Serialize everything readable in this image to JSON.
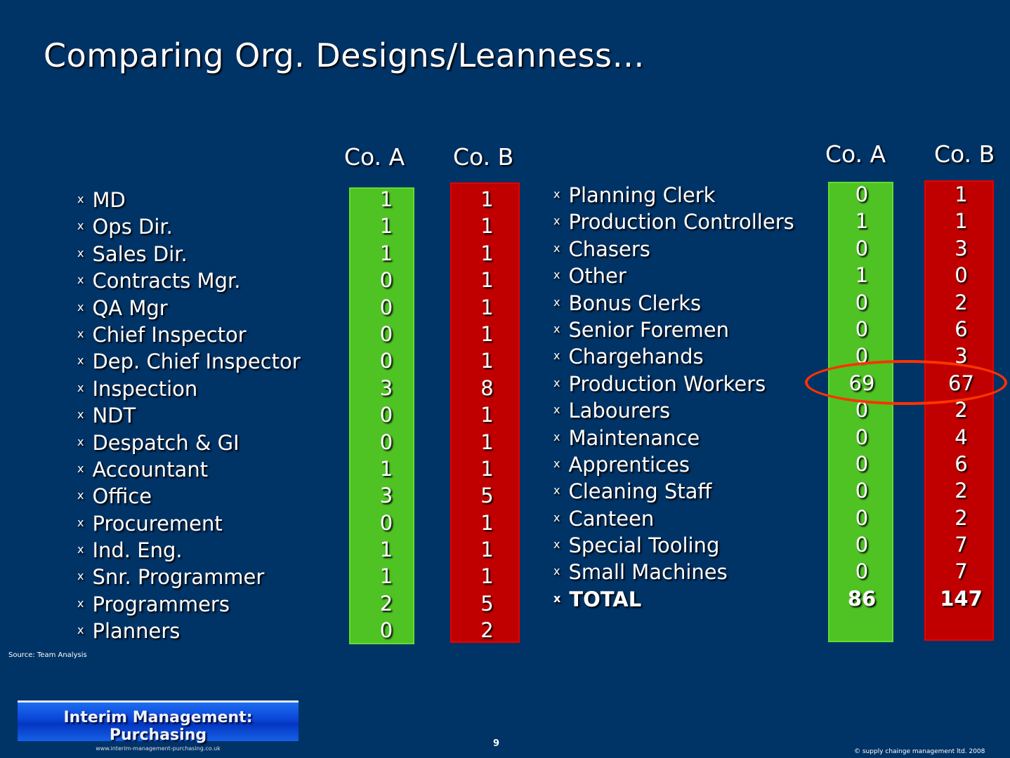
{
  "title": "Comparing Org. Designs/Leanness…",
  "bullet": "x",
  "headers": {
    "co_a": "Co. A",
    "co_b": "Co. B"
  },
  "left_table": [
    {
      "role": "MD",
      "co_a": "1",
      "co_b": "1"
    },
    {
      "role": "Ops Dir.",
      "co_a": "1",
      "co_b": "1"
    },
    {
      "role": "Sales Dir.",
      "co_a": "1",
      "co_b": "1"
    },
    {
      "role": "Contracts Mgr.",
      "co_a": "0",
      "co_b": "1"
    },
    {
      "role": "QA Mgr",
      "co_a": "0",
      "co_b": "1"
    },
    {
      "role": "Chief  Inspector",
      "co_a": "0",
      "co_b": "1"
    },
    {
      "role": "Dep. Chief Inspector",
      "co_a": "0",
      "co_b": "1"
    },
    {
      "role": "Inspection",
      "co_a": "3",
      "co_b": "8"
    },
    {
      "role": "NDT",
      "co_a": "0",
      "co_b": "1"
    },
    {
      "role": "Despatch & GI",
      "co_a": "0",
      "co_b": "1"
    },
    {
      "role": "Accountant",
      "co_a": "1",
      "co_b": "1"
    },
    {
      "role": "Office",
      "co_a": "3",
      "co_b": "5"
    },
    {
      "role": "Procurement",
      "co_a": "0",
      "co_b": "1"
    },
    {
      "role": "Ind. Eng.",
      "co_a": "1",
      "co_b": "1"
    },
    {
      "role": "Snr. Programmer",
      "co_a": "1",
      "co_b": "1"
    },
    {
      "role": "Programmers",
      "co_a": "2",
      "co_b": "5"
    },
    {
      "role": "Planners",
      "co_a": "0",
      "co_b": "2"
    }
  ],
  "right_table": [
    {
      "role": "Planning Clerk",
      "co_a": "0",
      "co_b": "1"
    },
    {
      "role": "Production Controllers",
      "co_a": "1",
      "co_b": "1"
    },
    {
      "role": "Chasers",
      "co_a": "0",
      "co_b": "3"
    },
    {
      "role": "Other",
      "co_a": "1",
      "co_b": "0"
    },
    {
      "role": "Bonus Clerks",
      "co_a": "0",
      "co_b": "2"
    },
    {
      "role": "Senior Foremen",
      "co_a": "0",
      "co_b": "6"
    },
    {
      "role": "Chargehands",
      "co_a": "0",
      "co_b": "3"
    },
    {
      "role": "Production Workers",
      "co_a": "69",
      "co_b": "67"
    },
    {
      "role": "Labourers",
      "co_a": "0",
      "co_b": "2"
    },
    {
      "role": "Maintenance",
      "co_a": "0",
      "co_b": "4"
    },
    {
      "role": "Apprentices",
      "co_a": "0",
      "co_b": "6"
    },
    {
      "role": "Cleaning Staff",
      "co_a": "0",
      "co_b": "2"
    },
    {
      "role": "Canteen",
      "co_a": "0",
      "co_b": "2"
    },
    {
      "role": "Special Tooling",
      "co_a": "0",
      "co_b": "7"
    },
    {
      "role": "Small Machines",
      "co_a": "0",
      "co_b": "7"
    }
  ],
  "total": {
    "role": "TOTAL",
    "co_a": "86",
    "co_b": "147"
  },
  "highlight": "Production Workers",
  "colors": {
    "background": "#003366",
    "co_a": "#4fc224",
    "co_b": "#c00000",
    "highlight": "#ff3300"
  },
  "source": "Source:  Team Analysis",
  "banner": {
    "title": "Interim Management: Purchasing",
    "url": "www.interim-management-purchasing.co.uk"
  },
  "page_number": "9",
  "copyright": "©  supply chainge management  ltd.  2008"
}
